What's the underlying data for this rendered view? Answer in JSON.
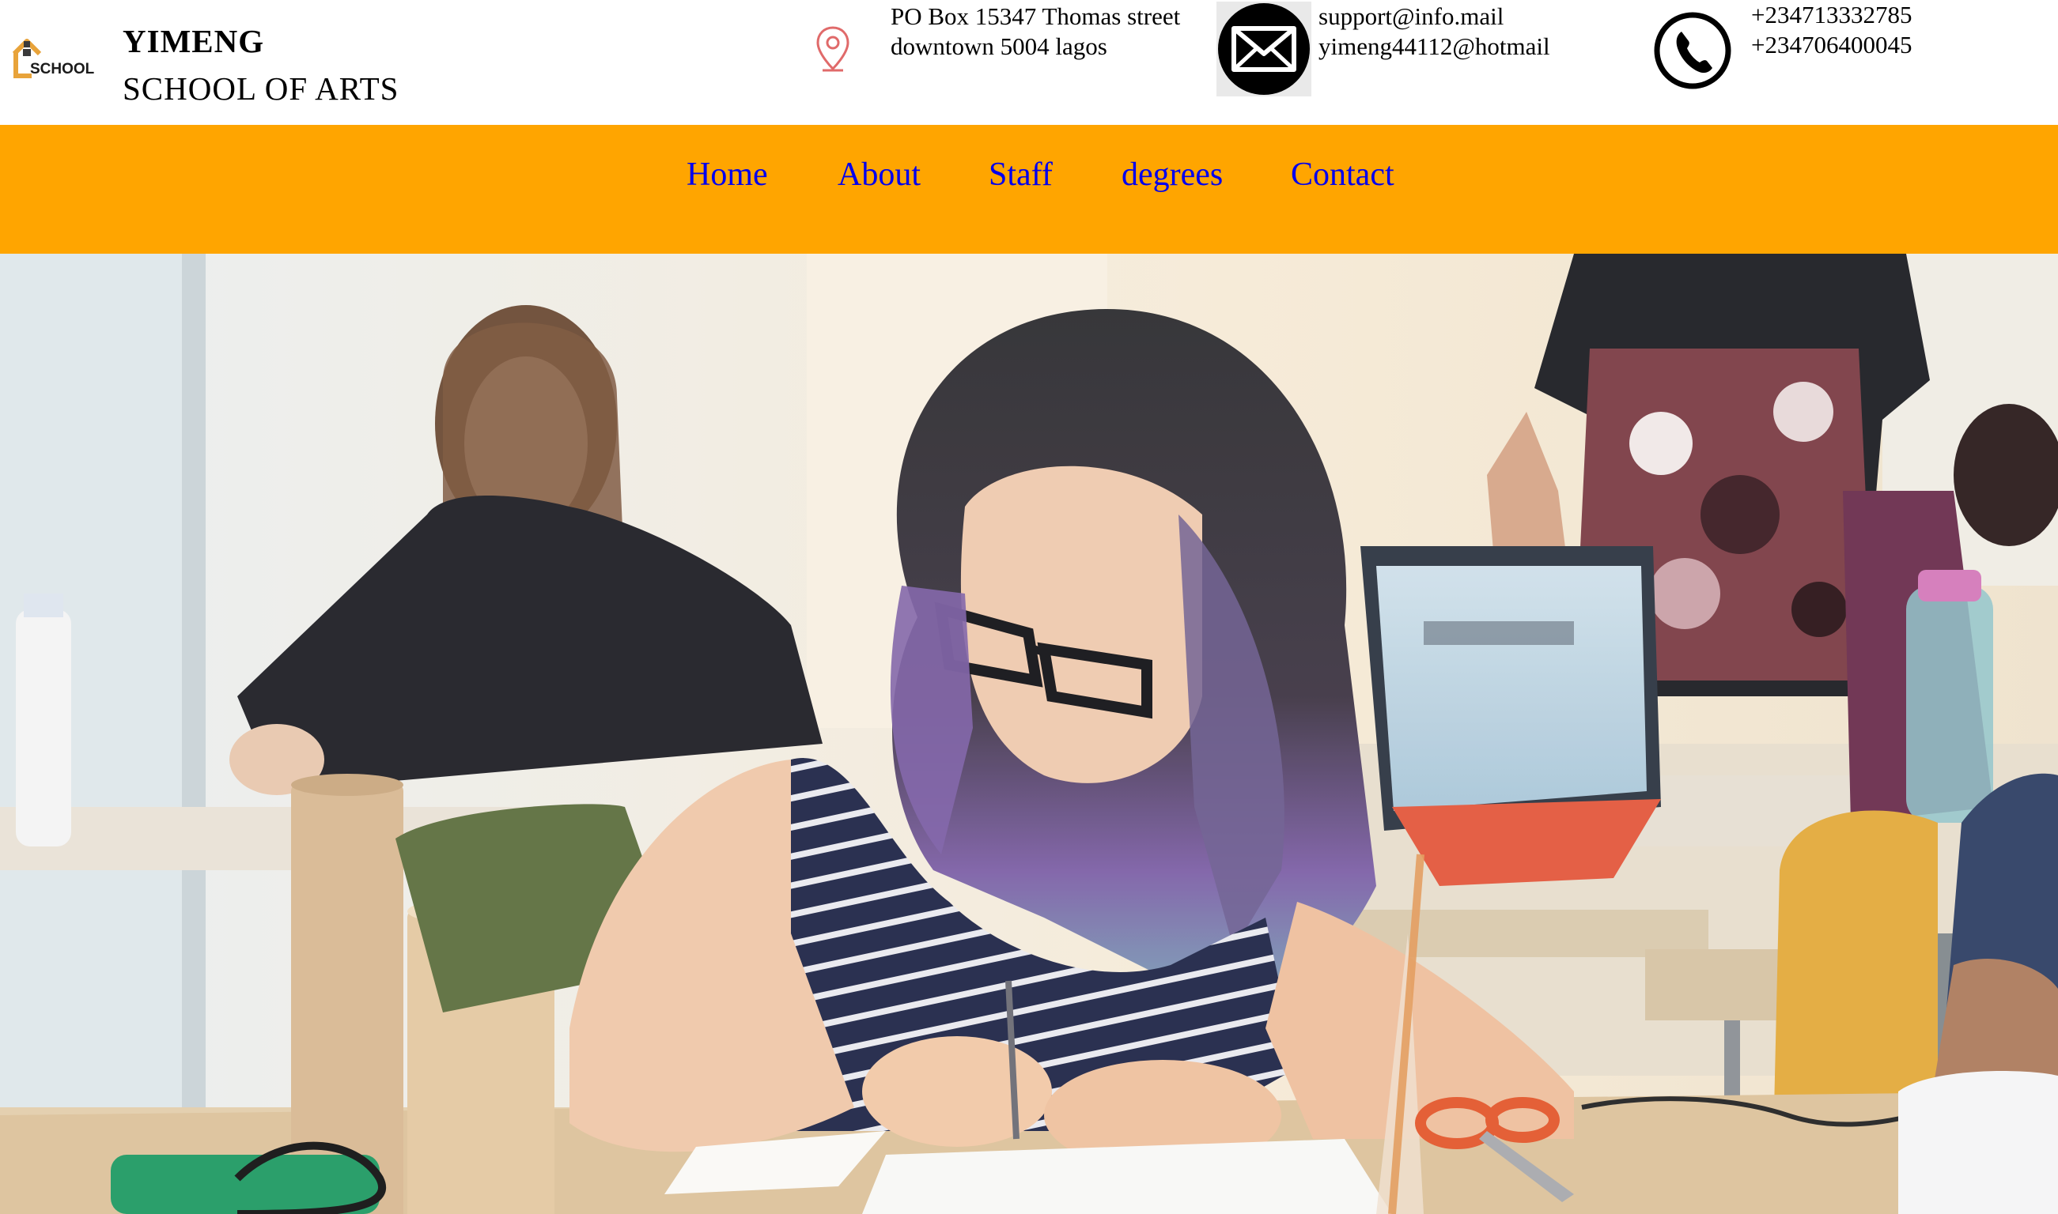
{
  "header": {
    "logo": {
      "text": "SCHOOL",
      "icon": "house-icon"
    },
    "brand_name": "YIMENG",
    "brand_sub": "SCHOOL OF ARTS",
    "address": {
      "icon": "location-pin-icon",
      "line1": "PO Box 15347 Thomas street",
      "line2": "downtown 5004 lagos"
    },
    "email": {
      "icon": "envelope-icon",
      "line1": "support@info.mail",
      "line2": "yimeng44112@hotmail"
    },
    "phone": {
      "icon": "phone-icon",
      "line1": "+234713332785",
      "line2": "+234706400045"
    }
  },
  "nav": {
    "items": [
      {
        "label": "Home"
      },
      {
        "label": "About"
      },
      {
        "label": "Staff"
      },
      {
        "label": "degrees"
      },
      {
        "label": "Contact"
      }
    ]
  },
  "colors": {
    "nav_background": "#ffa500",
    "nav_link": "#0000ee",
    "pin_icon": "#e06a6a",
    "logo_accent": "#e8a33a"
  }
}
